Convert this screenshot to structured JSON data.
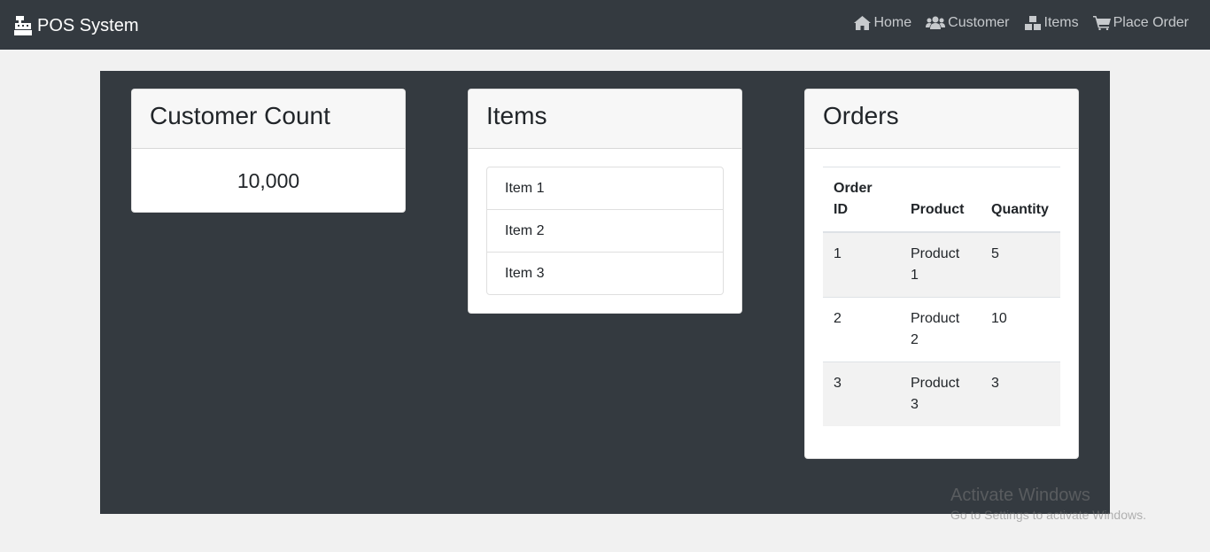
{
  "navbar": {
    "brand": "POS System",
    "links": [
      {
        "label": "Home",
        "icon": "home-icon"
      },
      {
        "label": "Customer",
        "icon": "users-icon"
      },
      {
        "label": "Items",
        "icon": "cubes-icon"
      },
      {
        "label": "Place Order",
        "icon": "cart-icon"
      }
    ]
  },
  "cards": {
    "customers": {
      "title": "Customer Count",
      "value": "10,000"
    },
    "items": {
      "title": "Items",
      "list": [
        "Item 1",
        "Item 2",
        "Item 3"
      ]
    },
    "orders": {
      "title": "Orders",
      "columns": [
        "Order ID",
        "Product",
        "Quantity"
      ],
      "rows": [
        [
          "1",
          "Product 1",
          "5"
        ],
        [
          "2",
          "Product 2",
          "10"
        ],
        [
          "3",
          "Product 3",
          "3"
        ]
      ]
    }
  },
  "watermark": {
    "title": "Activate Windows",
    "subtitle": "Go to Settings to activate Windows."
  },
  "colors": {
    "navbar": "#343a40",
    "background": "#f1f1f1",
    "panel": "#343a40"
  }
}
